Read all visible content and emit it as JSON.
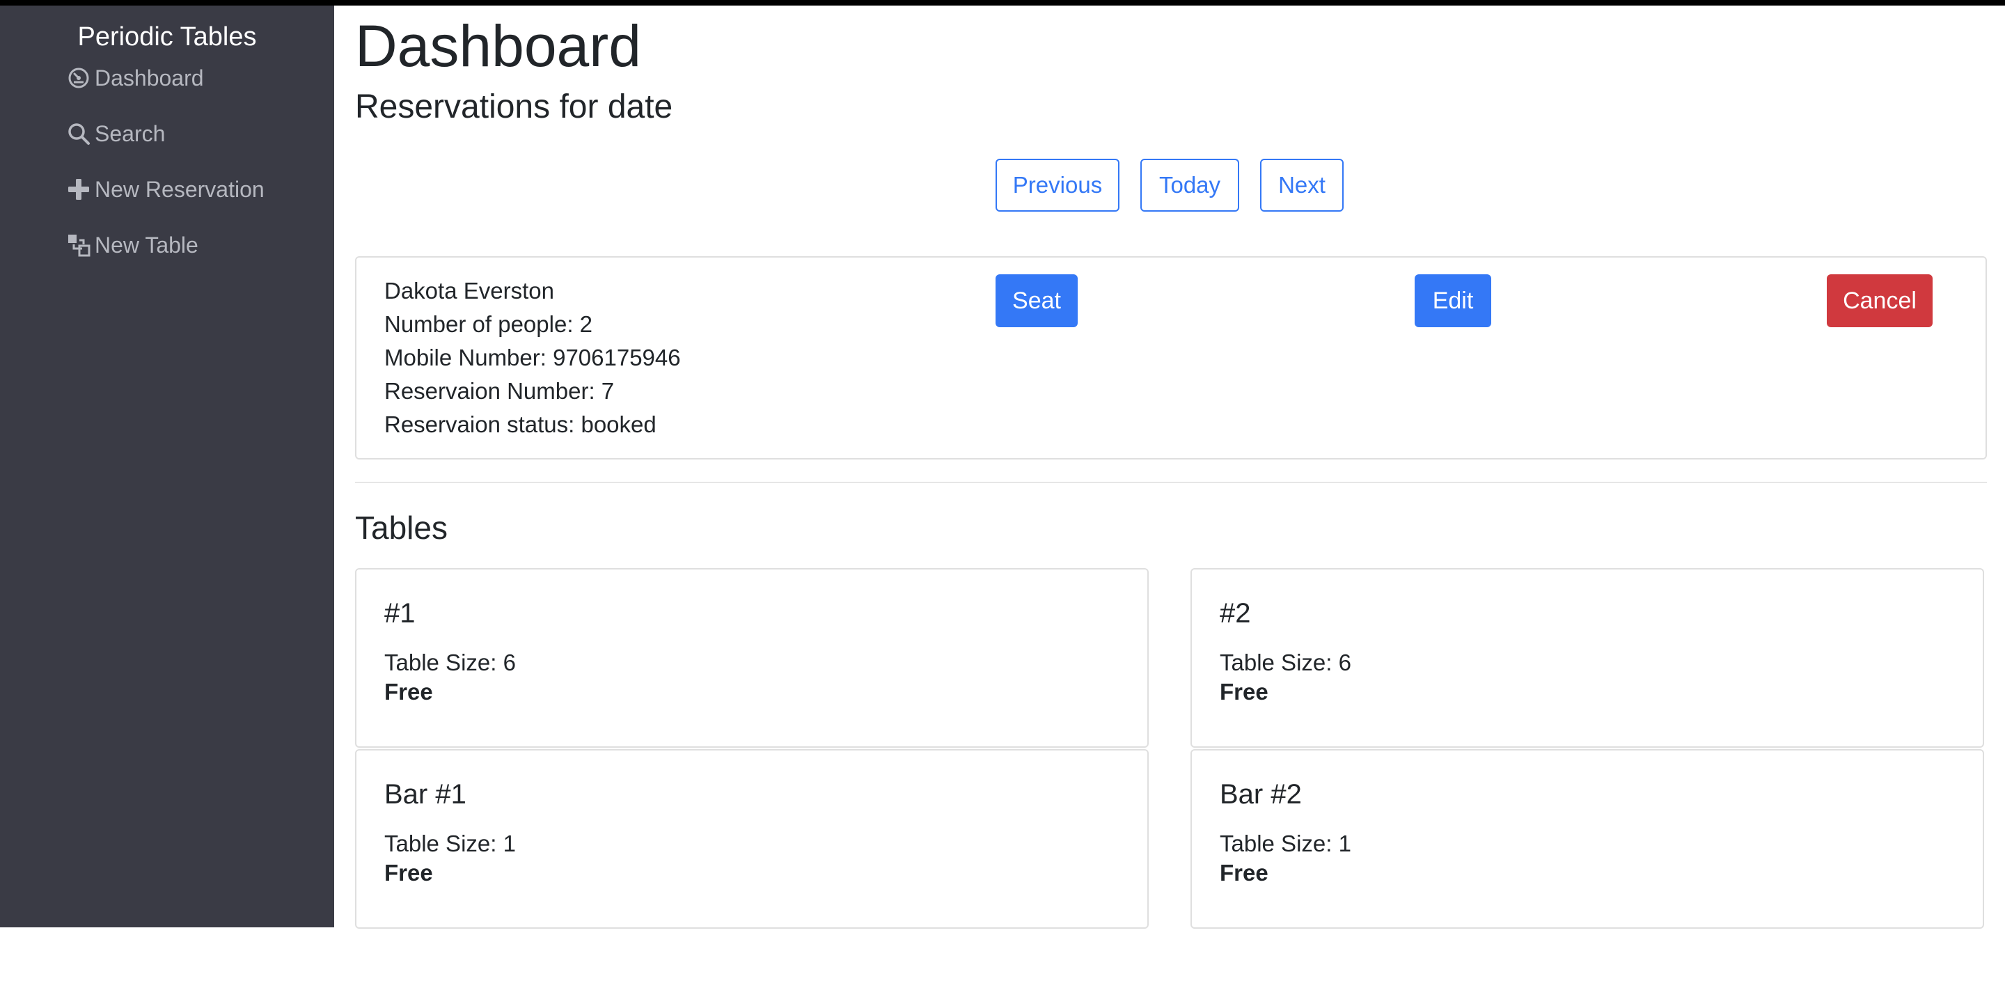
{
  "sidebar": {
    "brand": "Periodic Tables",
    "items": [
      {
        "label": "Dashboard",
        "icon": "dashboard-gauge-icon"
      },
      {
        "label": "Search",
        "icon": "search-icon"
      },
      {
        "label": "New Reservation",
        "icon": "plus-icon"
      },
      {
        "label": "New Table",
        "icon": "layers-icon"
      }
    ]
  },
  "main": {
    "title": "Dashboard",
    "subtitle": "Reservations for date",
    "date_nav": {
      "previous": "Previous",
      "today": "Today",
      "next": "Next"
    },
    "reservation": {
      "name": "Dakota Everston",
      "people": "Number of people: 2",
      "mobile": "Mobile Number: 9706175946",
      "number": "Reservaion Number: 7",
      "status": "Reservaion status: booked",
      "actions": {
        "seat": "Seat",
        "edit": "Edit",
        "cancel": "Cancel"
      }
    },
    "tables_heading": "Tables",
    "tables": [
      {
        "name": "#1",
        "size": "Table Size: 6",
        "status": "Free"
      },
      {
        "name": "#2",
        "size": "Table Size: 6",
        "status": "Free"
      },
      {
        "name": "Bar #1",
        "size": "Table Size: 1",
        "status": "Free"
      },
      {
        "name": "Bar #2",
        "size": "Table Size: 1",
        "status": "Free"
      }
    ]
  },
  "colors": {
    "sidebar_bg": "#3a3b45",
    "primary": "#3478f6",
    "danger": "#d0393e",
    "text": "#212529"
  }
}
